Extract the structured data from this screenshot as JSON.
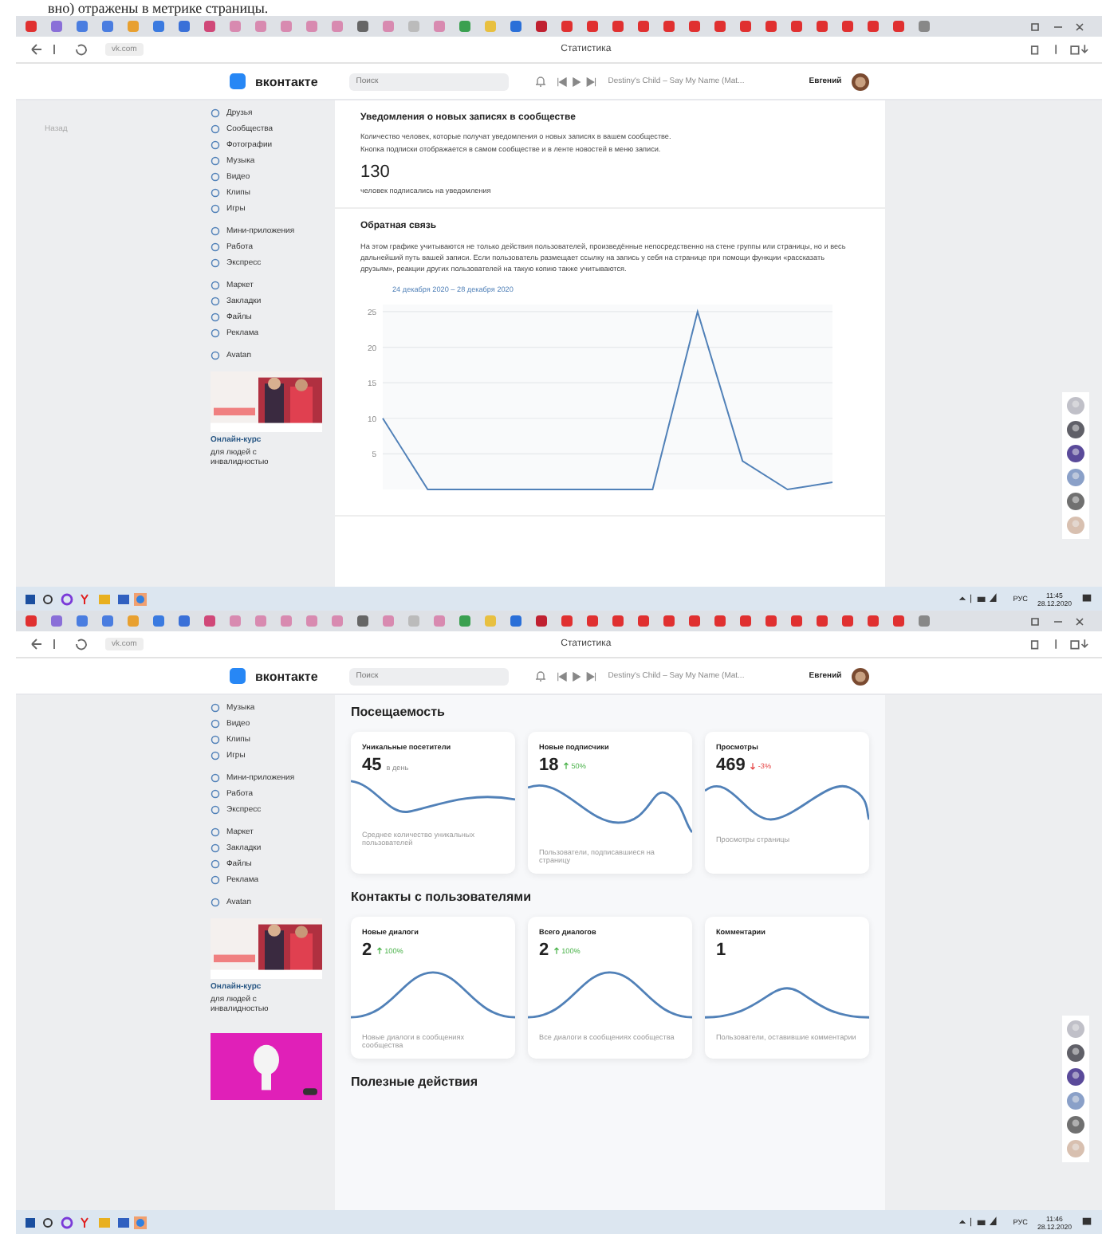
{
  "caption": "вно) отражены в метрике страницы.",
  "screens": [
    {
      "kind": "posts",
      "browser": {
        "page_title": "Статистика",
        "url": "vk.com"
      },
      "header": {
        "logo": "вконтакте",
        "search_placeholder": "Поиск",
        "track": "Destiny's Child – Say My Name (Mat...",
        "user": "Евгений"
      },
      "back_link": "Назад",
      "sidebar": [
        {
          "items": [
            "Друзья",
            "Сообщества",
            "Фотографии",
            "Музыка",
            "Видео",
            "Клипы",
            "Игры"
          ]
        },
        {
          "items": [
            "Мини-приложения",
            "Работа",
            "Экспресс"
          ]
        },
        {
          "items": [
            "Маркет",
            "Закладки",
            "Файлы",
            "Реклама"
          ]
        },
        {
          "items": [
            "Avatan"
          ]
        }
      ],
      "ads": [
        {
          "title": "Онлайн-курс",
          "text": "для людей с инвалидностью"
        }
      ],
      "notifications": {
        "title": "Уведомления о новых записях в сообществе",
        "description": [
          "Количество человек, которые получат уведомления о новых записях в вашем сообществе.",
          "Кнопка подписки отображается в самом сообществе и в ленте новостей в меню записи."
        ],
        "count": "130",
        "count_label": "человек подписались на уведомления"
      },
      "feedback": {
        "title": "Обратная связь",
        "text": "На этом графике учитываются не только действия пользователей, произведённые непосредственно на стене группы или страницы, но и весь дальнейший путь вашей записи. Если пользователь размещает ссылку на запись у себя на странице при помощи функции «рассказать друзьям», реакции других пользователей на такую копию также учитываются.",
        "period": "24 декабря 2020 – 28 декабря 2020",
        "chart_data": {
          "type": "line",
          "grid": true,
          "ylim": [
            0,
            26
          ],
          "yticks": [
            5,
            10,
            15,
            20,
            25
          ],
          "series": [
            {
              "color": "#5181b8",
              "values": [
                10,
                0,
                0,
                0,
                0,
                0,
                0,
                25,
                4,
                0,
                1
              ]
            }
          ]
        }
      },
      "taskbar": {
        "time": "11:45",
        "date": "28.12.2020",
        "lang": "РУС"
      }
    },
    {
      "kind": "dashboard",
      "browser": {
        "page_title": "Статистика",
        "url": "vk.com"
      },
      "header": {
        "logo": "вконтакте",
        "search_placeholder": "Поиск",
        "track": "Destiny's Child – Say My Name (Mat...",
        "user": "Евгений"
      },
      "sidebar": [
        {
          "items": [
            "Музыка",
            "Видео",
            "Клипы",
            "Игры"
          ]
        },
        {
          "items": [
            "Мини-приложения",
            "Работа",
            "Экспресс"
          ]
        },
        {
          "items": [
            "Маркет",
            "Закладки",
            "Файлы",
            "Реклама"
          ]
        },
        {
          "items": [
            "Avatan"
          ]
        }
      ],
      "ads": [
        {
          "title": "Онлайн-курс",
          "text": "для людей с инвалидностью"
        },
        {
          "kind": "poster"
        }
      ],
      "sections": [
        {
          "title": "Посещаемость",
          "cards": [
            {
              "title": "Уникальные посетители",
              "value": "45",
              "unit": "в день",
              "description": "Среднее количество уникальных пользователей"
            },
            {
              "title": "Новые подписчики",
              "value": "18",
              "change": "50%",
              "rising": true,
              "description": "Пользователи, подписавшиеся на страницу"
            },
            {
              "title": "Просмотры",
              "value": "469",
              "change": "-3%",
              "rising": false,
              "description": "Просмотры страницы"
            }
          ]
        },
        {
          "title": "Контакты с пользователями",
          "cards": [
            {
              "title": "Новые диалоги",
              "value": "2",
              "change": "100%",
              "rising": true,
              "description": "Новые диалоги в сообщениях сообщества"
            },
            {
              "title": "Всего диалогов",
              "value": "2",
              "change": "100%",
              "rising": true,
              "description": "Все диалоги в сообщениях сообщества"
            },
            {
              "title": "Комментарии",
              "value": "1",
              "description": "Пользователи, оставившие комментарии"
            }
          ]
        },
        {
          "title": "Полезные действия"
        }
      ],
      "taskbar": {
        "time": "11:46",
        "date": "28.12.2020",
        "lang": "РУС"
      }
    }
  ]
}
